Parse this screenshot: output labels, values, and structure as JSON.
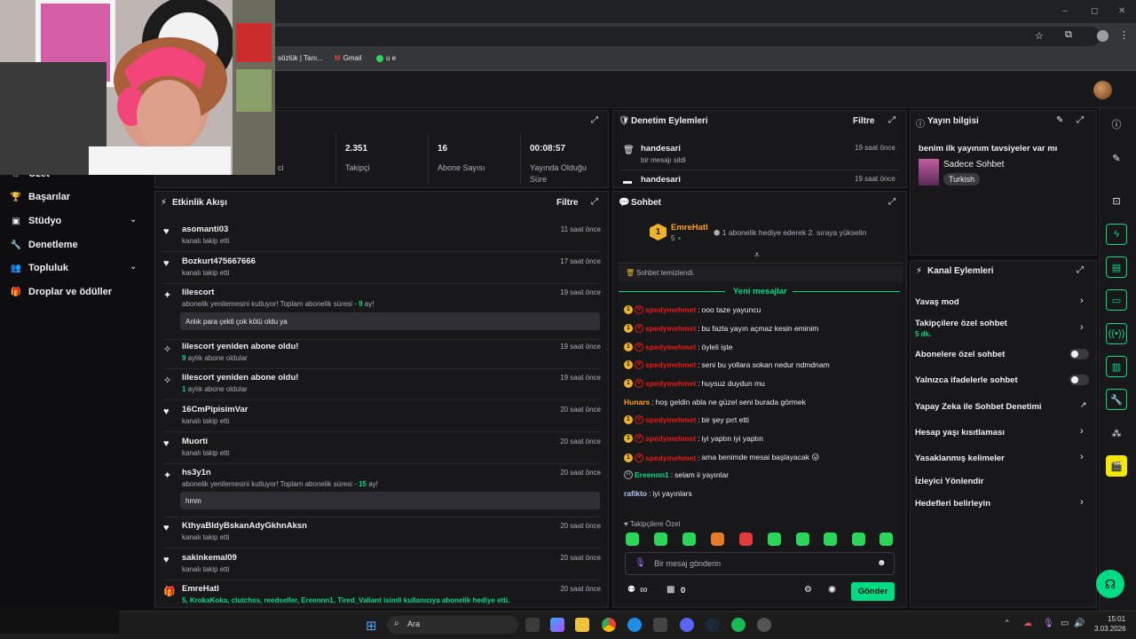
{
  "browser": {
    "bookmarks": [
      {
        "label": "sözlük | Tanı..."
      },
      {
        "label": "Gmail"
      },
      {
        "label": "u e"
      }
    ],
    "window_controls": [
      "–",
      "◻",
      "✕"
    ]
  },
  "nav": {
    "items": [
      {
        "label": "Özet"
      },
      {
        "label": "Başarılar"
      },
      {
        "label": "Stüdyo"
      },
      {
        "label": "Denetleme"
      },
      {
        "label": "Topluluk"
      },
      {
        "label": "Droplar ve ödüller"
      }
    ]
  },
  "stats": [
    {
      "value": "",
      "label": "ci"
    },
    {
      "value": "2.351",
      "label": "Takipçi"
    },
    {
      "value": "16",
      "label": "Abone Sayısı"
    },
    {
      "value": "00:08:57",
      "label": "Yayında Olduğu Süre"
    }
  ],
  "mod_actions": {
    "title": "Denetim Eylemleri",
    "filter": "Filtre",
    "entries": [
      {
        "user": "handesari",
        "action": "bir mesajı sildi",
        "time": "19 saat önce"
      },
      {
        "user": "handesari",
        "action": "",
        "time": "19 saat önce"
      }
    ]
  },
  "stream_info": {
    "title": "Yayın bilgisi",
    "stream_title": "benim ilk yayınım tavsiyeler var mı",
    "category": "Sadece Sohbet",
    "tag": "Turkish"
  },
  "activity": {
    "title": "Etkinlik Akışı",
    "filter": "Filtre",
    "items": [
      {
        "name": "asomanti03",
        "sub": "kanalı takip etti",
        "time": "11 saat önce"
      },
      {
        "name": "Bozkurt475667666",
        "sub": "kanalı takip etti",
        "time": "17 saat önce"
      },
      {
        "name": "lilescort",
        "sub_pre": "abonelik yenilemesini kutluyor! Toplam abonelik süresi - ",
        "sub_num": "9",
        "sub_post": " ay!",
        "time": "19 saat önce",
        "message": "Anlık para çekti çok kötü oldu ya"
      },
      {
        "name": "lilescort yeniden abone oldu!",
        "sub_num": "9",
        "sub_post": " aylık abone oldular",
        "time": "19 saat önce"
      },
      {
        "name": "lilescort yeniden abone oldu!",
        "sub_num": "1",
        "sub_post": " aylık abone oldular",
        "time": "19 saat önce"
      },
      {
        "name": "16CmPipisimVar",
        "sub": "kanalı takip etti",
        "time": "20 saat önce"
      },
      {
        "name": "Muorti",
        "sub": "kanalı takip etti",
        "time": "20 saat önce"
      },
      {
        "name": "hs3y1n",
        "sub_pre": "abonelik yenilemesini kutluyor! Toplam abonelik süresi - ",
        "sub_num": "15",
        "sub_post": " ay!",
        "time": "20 saat önce",
        "message": "hmm"
      },
      {
        "name": "KthyaBldyBskanAdyGkhnAksn",
        "sub": "kanalı takip etti",
        "time": "20 saat önce"
      },
      {
        "name": "sakinkemal09",
        "sub": "kanalı takip etti",
        "time": "20 saat önce"
      },
      {
        "name": "EmreHatl",
        "sub_num": "5",
        "sub_post": ", KrokaKoka, clutchss, reedseller, Ereennn1, Tired_Valiant isimli kullanıcıya abonelik hediye etti.",
        "time": "20 saat önce"
      }
    ]
  },
  "chat": {
    "title": "Sohbet",
    "pinned_user": "EmreHatl",
    "pinned_count": "5",
    "pinned_rank": "1",
    "pinned_text": "1 abonelik hediye ederek 2. sıraya yükselin",
    "cleared": "Sohbet temizlendi.",
    "new_messages": "Yeni mesajlar",
    "messages": [
      {
        "user": "spedymehmet",
        "color": "red",
        "badges": true,
        "text": "ooo taze yayuncu"
      },
      {
        "user": "spedymehmet",
        "color": "red",
        "badges": true,
        "text": "bu fazla yayın açmaz kesin eminim"
      },
      {
        "user": "spedymehmet",
        "color": "red",
        "badges": true,
        "text": "öyleli işte"
      },
      {
        "user": "spedymehmet",
        "color": "red",
        "badges": true,
        "text": "seni bu yollara sokan nedur ndmdnam"
      },
      {
        "user": "spedymehmet",
        "color": "red",
        "badges": true,
        "text": "huysuz duydun mu"
      },
      {
        "user": "Hunars",
        "color": "orange",
        "badges": false,
        "text": "hoş geldin abla ne güzel seni burada görmek"
      },
      {
        "user": "spedymehmet",
        "color": "red",
        "badges": true,
        "text": "bir şey pırt etti"
      },
      {
        "user": "spedymehmet",
        "color": "red",
        "badges": true,
        "text": "iyi yaptın iyi yaptın"
      },
      {
        "user": "spedymehmet",
        "color": "red",
        "badges": true,
        "text": "ama benimde mesai başlayacak 😛"
      },
      {
        "user": "Ereennn1",
        "color": "green",
        "badges": false,
        "text": "selam ii yayınlar"
      },
      {
        "user": "rafikto",
        "color": "blue",
        "badges": false,
        "text": "iyi yayınlars"
      }
    ],
    "emote_section": "Takipçilere Özel",
    "input_placeholder": "Bir mesaj gönderin",
    "points": "∞",
    "bits": "0",
    "send_label": "Gönder"
  },
  "channel_actions": {
    "title": "Kanal Eylemleri",
    "items": [
      {
        "label": "Yavaş mod"
      },
      {
        "label": "Takipçilere özel sohbet",
        "sub": "5 dk."
      },
      {
        "label": "Abonelere özel sohbet"
      },
      {
        "label": "Yalnızca ifadelerle sohbet"
      },
      {
        "label": "Yapay Zeka ile Sohbet Denetimi"
      },
      {
        "label": "Hesap yaşı kısıtlaması"
      },
      {
        "label": "Yasaklanmış kelimeler"
      },
      {
        "label": "İzleyici Yönlendir"
      },
      {
        "label": "Hedefleri belirleyin"
      }
    ]
  },
  "taskbar": {
    "search_label": "Ara",
    "time": "15:01",
    "date": "3.03.2026"
  },
  "colors": {
    "accent": "#00db84",
    "twitch_purple": "#9147ff",
    "bg": "#0e0e10",
    "panel": "#18181b"
  }
}
